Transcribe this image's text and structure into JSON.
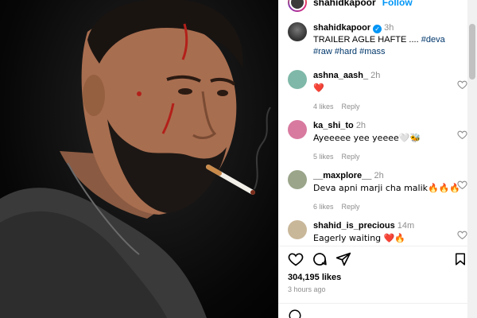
{
  "post": {
    "username": "shahidkapoor",
    "follow_label": "Follow",
    "caption_time": "3h",
    "caption_text": "TRAILER AGLE HAFTE ....",
    "hashtags": [
      "#deva",
      "#raw",
      "#hard",
      "#mass"
    ],
    "likes": "304,195 likes",
    "posted_ago": "3 hours ago"
  },
  "comments": [
    {
      "username": "ashna_aash_",
      "time": "2h",
      "text": "❤️",
      "likes": "4 likes",
      "reply": "Reply",
      "avatar_color": "#7fb8a8"
    },
    {
      "username": "ka_shi_to",
      "time": "2h",
      "text": "Ayeeeee yee yeeee🤍🐝",
      "likes": "5 likes",
      "reply": "Reply",
      "avatar_color": "#d87aa0"
    },
    {
      "username": "__maxplore__",
      "time": "2h",
      "text": "Deva apni marji cha malik🔥🔥🔥",
      "likes": "6 likes",
      "reply": "Reply",
      "avatar_color": "#9aa58a"
    },
    {
      "username": "shahid_is_precious",
      "time": "14m",
      "text": "Eagerly waiting ❤️🔥",
      "likes": "",
      "reply": "",
      "avatar_color": "#c9b79a"
    }
  ],
  "icons": {
    "like": "heart-icon",
    "comment": "comment-icon",
    "share": "send-icon",
    "save": "bookmark-icon",
    "verified": "verified-badge-icon",
    "comment_like": "heart-outline-icon"
  },
  "colors": {
    "link_blue": "#0095f6",
    "hashtag": "#00376b",
    "muted": "#8e8e8e",
    "heart_red": "#ed4956"
  }
}
